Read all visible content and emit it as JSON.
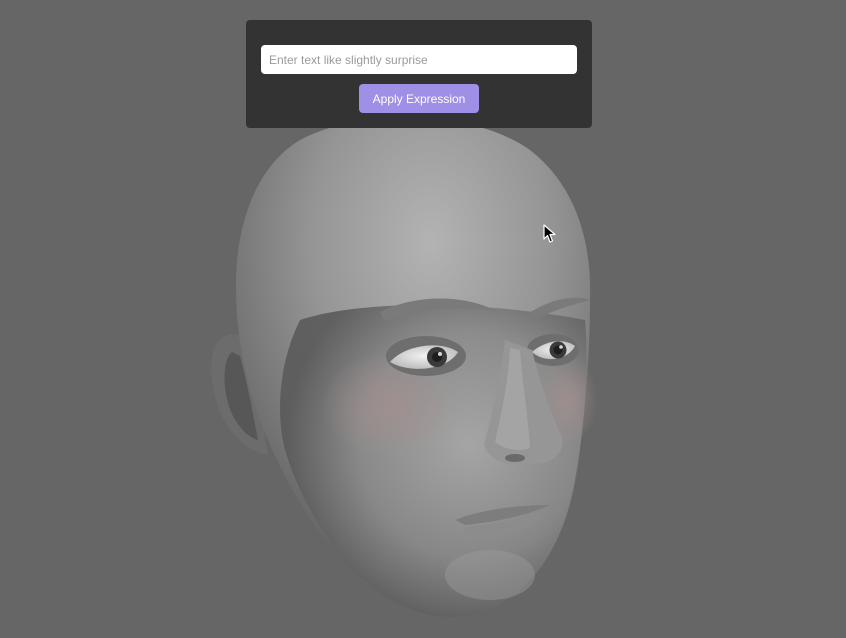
{
  "expression_panel": {
    "input_placeholder": "Enter text like slightly surprise",
    "input_value": "",
    "apply_button_label": "Apply Expression"
  },
  "colors": {
    "background": "#666666",
    "panel": "#333333",
    "button": "#9f8fe6"
  }
}
